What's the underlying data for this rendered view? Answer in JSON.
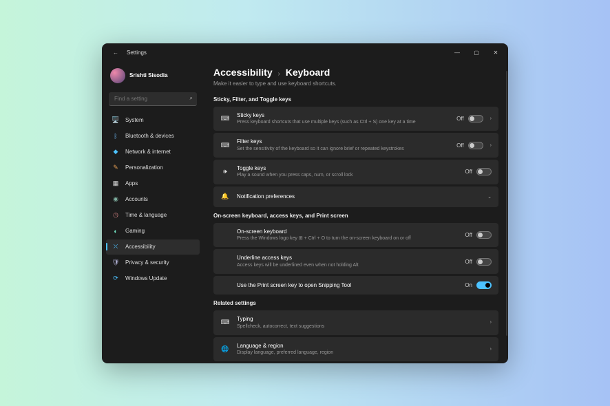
{
  "titlebar": {
    "title": "Settings"
  },
  "user": {
    "name": "Srishti Sisodia"
  },
  "search": {
    "placeholder": "Find a setting"
  },
  "nav": [
    {
      "icon": "🖥️",
      "label": "System",
      "color": "#6cb4ee"
    },
    {
      "icon": "ᛒ",
      "label": "Bluetooth & devices",
      "color": "#6cb4ee"
    },
    {
      "icon": "◆",
      "label": "Network & internet",
      "color": "#4cc2ff"
    },
    {
      "icon": "✎",
      "label": "Personalization",
      "color": "#e8a055"
    },
    {
      "icon": "▦",
      "label": "Apps",
      "color": "#ddd"
    },
    {
      "icon": "◉",
      "label": "Accounts",
      "color": "#7fb0a0"
    },
    {
      "icon": "◷",
      "label": "Time & language",
      "color": "#d88"
    },
    {
      "icon": "◐",
      "label": "Gaming",
      "color": "#7ec"
    },
    {
      "icon": "⛌",
      "label": "Accessibility",
      "color": "#4cc2ff",
      "active": true
    },
    {
      "icon": "🛡",
      "label": "Privacy & security",
      "color": "#aac"
    },
    {
      "icon": "⟳",
      "label": "Windows Update",
      "color": "#4cc2ff"
    }
  ],
  "breadcrumb": {
    "parent": "Accessibility",
    "current": "Keyboard"
  },
  "subtitle": "Make it easier to type and use keyboard shortcuts.",
  "section1": {
    "heading": "Sticky, Filter, and Toggle keys",
    "sticky": {
      "title": "Sticky keys",
      "desc": "Press keyboard shortcuts that use multiple keys (such as Ctrl + S) one key at a time",
      "state": "Off"
    },
    "filter": {
      "title": "Filter keys",
      "desc": "Set the sensitivity of the keyboard so it can ignore brief or repeated keystrokes",
      "state": "Off"
    },
    "toggle": {
      "title": "Toggle keys",
      "desc": "Play a sound when you press caps, num, or scroll lock",
      "state": "Off"
    },
    "notif": {
      "title": "Notification preferences"
    }
  },
  "section2": {
    "heading": "On-screen keyboard, access keys, and Print screen",
    "osk": {
      "title": "On-screen keyboard",
      "desc": "Press the Windows logo key ⊞ + Ctrl + O to turn the on-screen keyboard on or off",
      "state": "Off"
    },
    "underline": {
      "title": "Underline access keys",
      "desc": "Access keys will be underlined even when not holding Alt",
      "state": "Off"
    },
    "prtsc": {
      "title": "Use the Print screen key to open Snipping Tool",
      "state": "On"
    }
  },
  "section3": {
    "heading": "Related settings",
    "typing": {
      "title": "Typing",
      "desc": "Spellcheck, autocorrect, text suggestions"
    },
    "lang": {
      "title": "Language & region",
      "desc": "Display language, preferred language, region"
    }
  }
}
